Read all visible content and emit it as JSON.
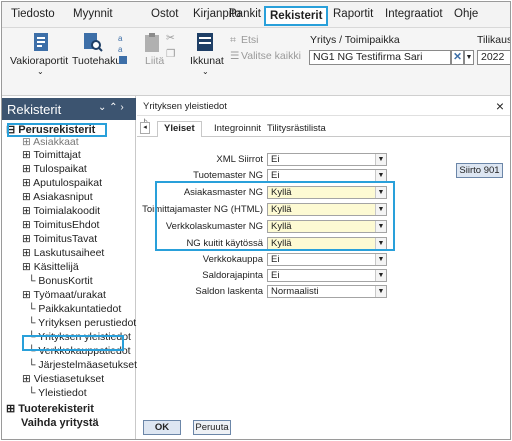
{
  "menu": [
    "Tiedosto",
    "Myynnit",
    "Ostot",
    "Kirjanpito",
    "Pankit",
    "Rekisterit",
    "Raportit",
    "Integraatiot",
    "Ohje"
  ],
  "ribbon": {
    "vakioraportit": "Vakioraportit",
    "tuotehaku": "Tuotehaku",
    "liita": "Liitä",
    "ikkunat": "Ikkunat",
    "etsi": "Etsi",
    "valitse_kaikki": "Valitse kaikki",
    "yritys_label": "Yritys / Toimipaikka",
    "yritys_value": "NG1 NG Testifirma Sari",
    "tilikausi_label": "Tilikaus",
    "tilikausi_value": "2022"
  },
  "sidebar": {
    "title": "Rekisterit",
    "root": "Perusrekisterit",
    "items": [
      "Asiakkaat",
      "Toimittajat",
      "Tulospaikat",
      "Aputulospaikat",
      "Asiakasniput",
      "Toimialakoodit",
      "ToimitusEhdot",
      "ToimitusTavat",
      "Laskutusaiheet",
      "Käsittelijä",
      "BonusKortit",
      "Työmaat/urakat",
      "Paikkakuntatiedot",
      "Yrityksen perustiedot",
      "Yrityksen yleistiedot",
      "Verkkokauppatiedot",
      "Järjestelmäasetukset",
      "Viestiasetukset",
      "Yleistiedot"
    ],
    "tuoterekisterit": "Tuoterekisterit",
    "vaihda": "Vaihda yritystä"
  },
  "panel": {
    "title": "Yrityksen yleistiedot",
    "close": "×",
    "tabs": [
      "Yleiset",
      "Integroinnit",
      "Tilitysrästilista"
    ],
    "fields": [
      {
        "label": "XML Siirrot",
        "value": "Ei"
      },
      {
        "label": "Tuotemaster NG",
        "value": "Ei"
      },
      {
        "label": "Asiakasmaster NG",
        "value": "Kyllä"
      },
      {
        "label": "Toimittajamaster NG (HTML)",
        "value": "Kyllä"
      },
      {
        "label": "Verkkolaskumaster NG",
        "value": "Kyllä"
      },
      {
        "label": "NG kuitit käytössä",
        "value": "Kyllä"
      },
      {
        "label": "Verkkokauppa",
        "value": "Ei"
      },
      {
        "label": "Saldorajapinta",
        "value": "Ei"
      },
      {
        "label": "Saldon laskenta",
        "value": "Normaalisti"
      }
    ],
    "siirto_button": "Siirto 901",
    "ok": "OK",
    "peruuta": "Peruuta"
  }
}
